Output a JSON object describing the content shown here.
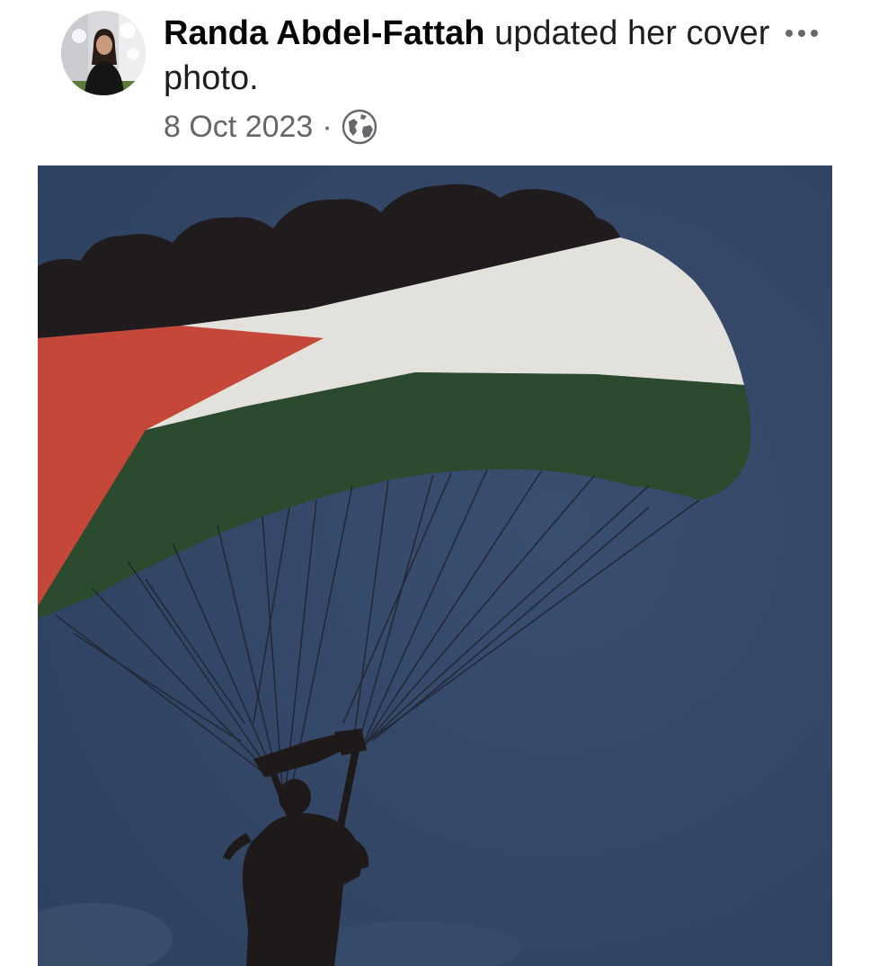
{
  "post": {
    "author_name": "Randa Abdel-Fattah",
    "action_text": "updated her cover photo.",
    "date": "8 Oct 2023",
    "separator": "·",
    "audience_icon": "globe-icon",
    "more_icon": "more-options-icon"
  },
  "colors": {
    "sky": "#344766",
    "flag_black": "#201c1d",
    "flag_white": "#e3e1dc",
    "flag_green": "#2b4a2e",
    "flag_red": "#c4473a",
    "meta_text": "#65676b"
  }
}
